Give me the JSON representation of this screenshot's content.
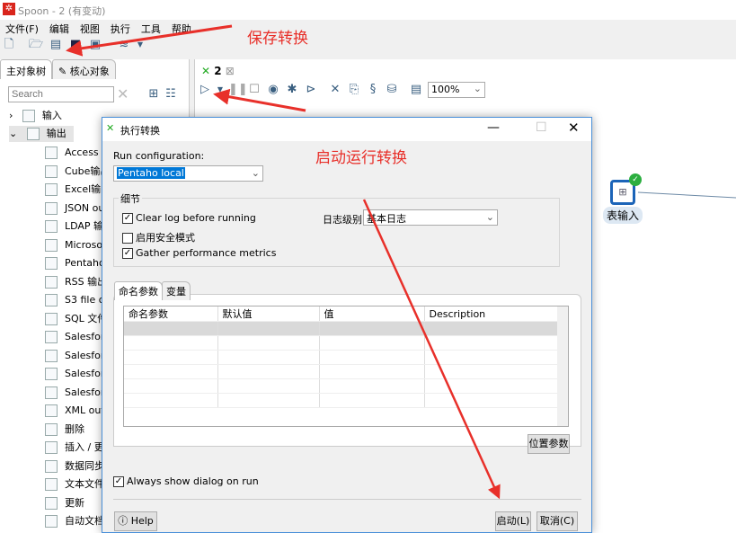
{
  "window": {
    "title": "Spoon - 2 (有变动)",
    "logo": "kettle-logo"
  },
  "menu": [
    "文件(F)",
    "编辑",
    "视图",
    "执行",
    "工具",
    "帮助"
  ],
  "left": {
    "tabs": [
      "主对象树",
      "核心对象"
    ],
    "search_placeholder": "Search",
    "tree": [
      {
        "label": "输入",
        "expanded": false
      },
      {
        "label": "输出",
        "expanded": true
      }
    ],
    "children": [
      "Access 输",
      "Cube输出",
      "Excel输出",
      "JSON ou",
      "LDAP 输",
      "Microsof",
      "Pentaho",
      "RSS 输出",
      "S3 file ou",
      "SQL 文件",
      "Salesforc",
      "Salesforc",
      "Salesforc",
      "Salesforc",
      "XML out",
      "删除",
      "插入 / 更",
      "数据同步",
      "文本文件",
      "更新",
      "自动文档"
    ]
  },
  "canvas": {
    "tab": "2",
    "zoom": "100%",
    "step": {
      "label": "表输入",
      "status": "ok"
    }
  },
  "dialog": {
    "title": "执行转换",
    "run_config_label": "Run configuration:",
    "run_config_value": "Pentaho local",
    "details_group": "细节",
    "clear_log": {
      "label": "Clear log before running",
      "checked": true
    },
    "safe_mode": {
      "label": "启用安全模式",
      "checked": false
    },
    "gather_metrics": {
      "label": "Gather performance metrics",
      "checked": true
    },
    "log_level_label": "日志级别",
    "log_level_value": "基本日志",
    "tabs": [
      "命名参数",
      "变量"
    ],
    "columns": [
      "命名参数",
      "默认值",
      "值",
      "Description"
    ],
    "position_params": "位置参数",
    "always_show": {
      "label": "Always show dialog on run",
      "checked": true
    },
    "help": "Help",
    "launch": "启动(L)",
    "cancel": "取消(C)"
  },
  "annotations": {
    "save": "保存转换",
    "run": "启动运行转换",
    "color": "#e8302a"
  }
}
